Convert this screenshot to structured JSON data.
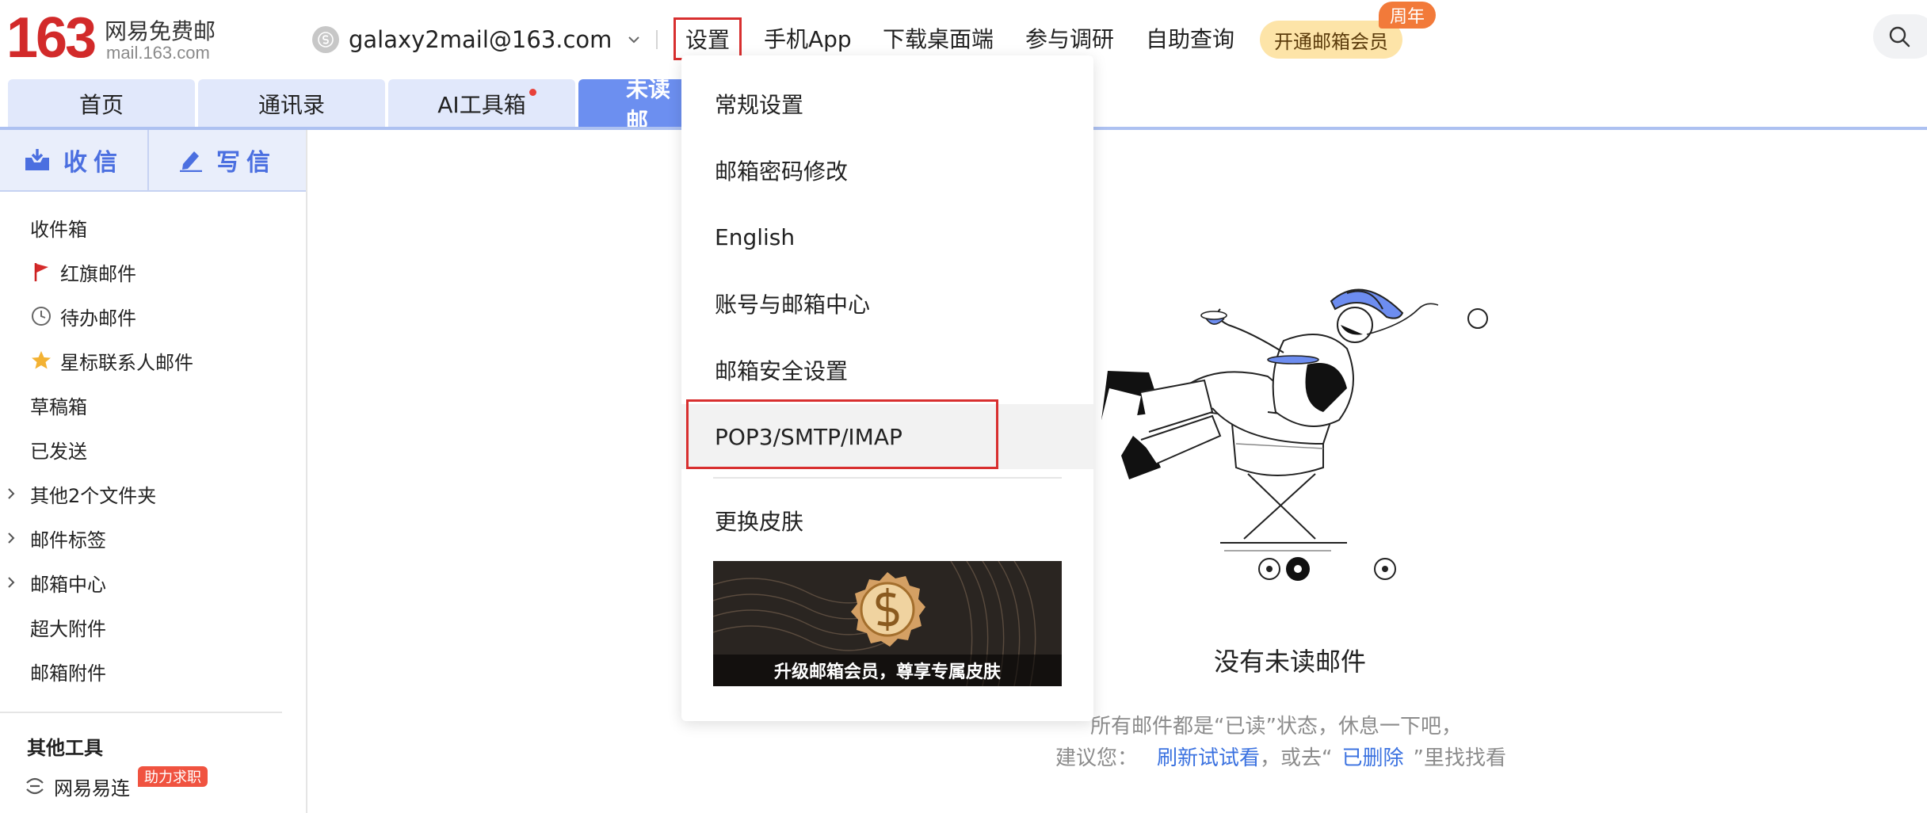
{
  "header": {
    "logo_number": "163",
    "logo_name": "网易免费邮",
    "logo_domain": "mail.163.com",
    "account_email": "galaxy2mail@163.com",
    "nav": [
      {
        "label": "设置"
      },
      {
        "label": "手机App"
      },
      {
        "label": "下载桌面端"
      },
      {
        "label": "参与调研"
      },
      {
        "label": "自助查询"
      }
    ],
    "vip_label": "开通邮箱会员",
    "vip_badge": "周年"
  },
  "tabs": [
    {
      "label": "首页"
    },
    {
      "label": "通讯录"
    },
    {
      "label": "AI工具箱"
    },
    {
      "label": "未读邮"
    }
  ],
  "sidebar": {
    "receive_label": "收信",
    "compose_label": "写信",
    "items": [
      {
        "label": "收件箱"
      },
      {
        "label": "红旗邮件"
      },
      {
        "label": "待办邮件"
      },
      {
        "label": "星标联系人邮件"
      },
      {
        "label": "草稿箱"
      },
      {
        "label": "已发送"
      },
      {
        "label": "其他2个文件夹"
      },
      {
        "label": "邮件标签"
      },
      {
        "label": "邮箱中心"
      },
      {
        "label": "超大附件"
      },
      {
        "label": "邮箱附件"
      }
    ],
    "section_title": "其他工具",
    "tool_label": "网易易连",
    "tool_badge": "助力求职"
  },
  "dropdown": {
    "items": [
      {
        "label": "常规设置"
      },
      {
        "label": "邮箱密码修改"
      },
      {
        "label": "English"
      },
      {
        "label": "账号与邮箱中心"
      },
      {
        "label": "邮箱安全设置"
      },
      {
        "label": "POP3/SMTP/IMAP"
      },
      {
        "label": "更换皮肤"
      }
    ],
    "banner_text": "升级邮箱会员，尊享专属皮肤"
  },
  "main": {
    "empty_title": "没有未读邮件",
    "empty_line1": "所有邮件都是“已读”状态，休息一下吧，",
    "empty_line2_prefix": "建议您：",
    "refresh_link": "刷新试试看",
    "empty_line2_mid": "，或去“",
    "deleted_link": "已删除",
    "empty_line2_suffix": "”里找找看"
  },
  "colors": {
    "logo_red": "#d22a2a",
    "accent_blue": "#4b6fe0",
    "active_tab": "#6c8ff0",
    "highlight_red": "#d82f2f"
  }
}
